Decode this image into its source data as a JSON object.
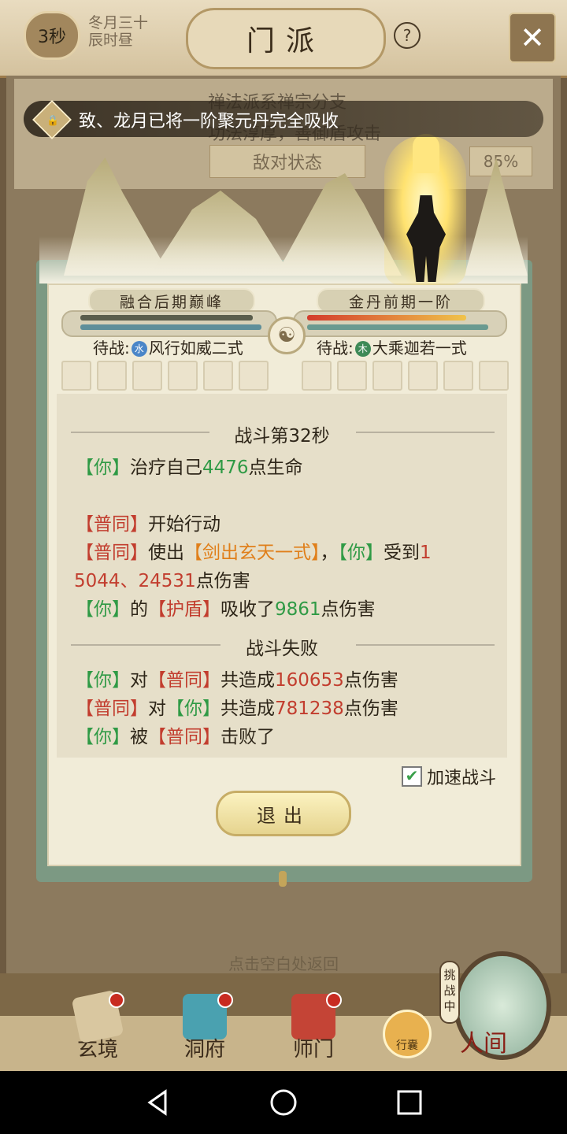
{
  "header": {
    "timer": "3秒",
    "date_line1": "冬月三十",
    "date_line2": "辰时昼",
    "title": "门派",
    "help_icon": "?",
    "close_icon": "✕"
  },
  "background": {
    "line1": "禅法派系禅宗分支",
    "line2": "功法淳厚，善御盾攻击",
    "status_button": "敌对状态",
    "percent": "85%",
    "hint": "点击空白处返回"
  },
  "notice": {
    "text": "致、龙月已将一阶聚元丹完全吸收"
  },
  "battle": {
    "left": {
      "rank": "融合后期巅峰",
      "hp_fraction": 0.95,
      "mp_fraction": 1.0,
      "waiting_label": "待战:",
      "element": "水",
      "element_color": "#4a86c8",
      "skill": "风行如威二式"
    },
    "right": {
      "rank": "金丹前期一阶",
      "hp_fraction": 0.88,
      "mp_fraction": 1.0,
      "waiting_label": "待战:",
      "element": "木",
      "element_color": "#3e8a57",
      "skill": "大乘迦若一式"
    }
  },
  "log": {
    "heading": "战斗第32秒",
    "line1": {
      "a": "【你】",
      "b": "治疗自己",
      "c": "4476",
      "d": "点生命"
    },
    "line2": {
      "a": "【普同】",
      "b": "开始行动"
    },
    "line3": {
      "a": "【普同】",
      "b": "使出",
      "c": "【剑出玄天一式】",
      "d": "，",
      "e": "【你】",
      "f": "受到",
      "g": "1"
    },
    "line4": {
      "a": "5044、24531",
      "b": "点伤害"
    },
    "line5": {
      "a": "【你】",
      "b": "的",
      "c": "【护盾】",
      "d": "吸收了",
      "e": "9861",
      "f": "点伤害"
    },
    "result": "战斗失败",
    "line6": {
      "a": "【你】",
      "b": "对",
      "c": "【普同】",
      "d": "共造成",
      "e": "160653",
      "f": "点伤害"
    },
    "line7": {
      "a": "【普同】",
      "b": "对",
      "c": "【你】",
      "d": "共造成",
      "e": "781238",
      "f": "点伤害"
    },
    "line8": {
      "a": "【你】",
      "b": "被",
      "c": "【普同】",
      "d": "击败了"
    }
  },
  "controls": {
    "speed_label": "加速战斗",
    "speed_checked": true,
    "exit_label": "退出"
  },
  "bottom_nav": {
    "items": [
      {
        "label": "玄境",
        "icon": "scroll-icon"
      },
      {
        "label": "洞府",
        "icon": "pavilion-icon"
      },
      {
        "label": "师门",
        "icon": "banner-icon"
      }
    ],
    "bag_label": "行囊",
    "challenge_label": "挑战中",
    "world_label": "人间"
  },
  "colors": {
    "green": "#2f9a45",
    "red": "#c23d2e",
    "orange": "#e07f1a"
  }
}
